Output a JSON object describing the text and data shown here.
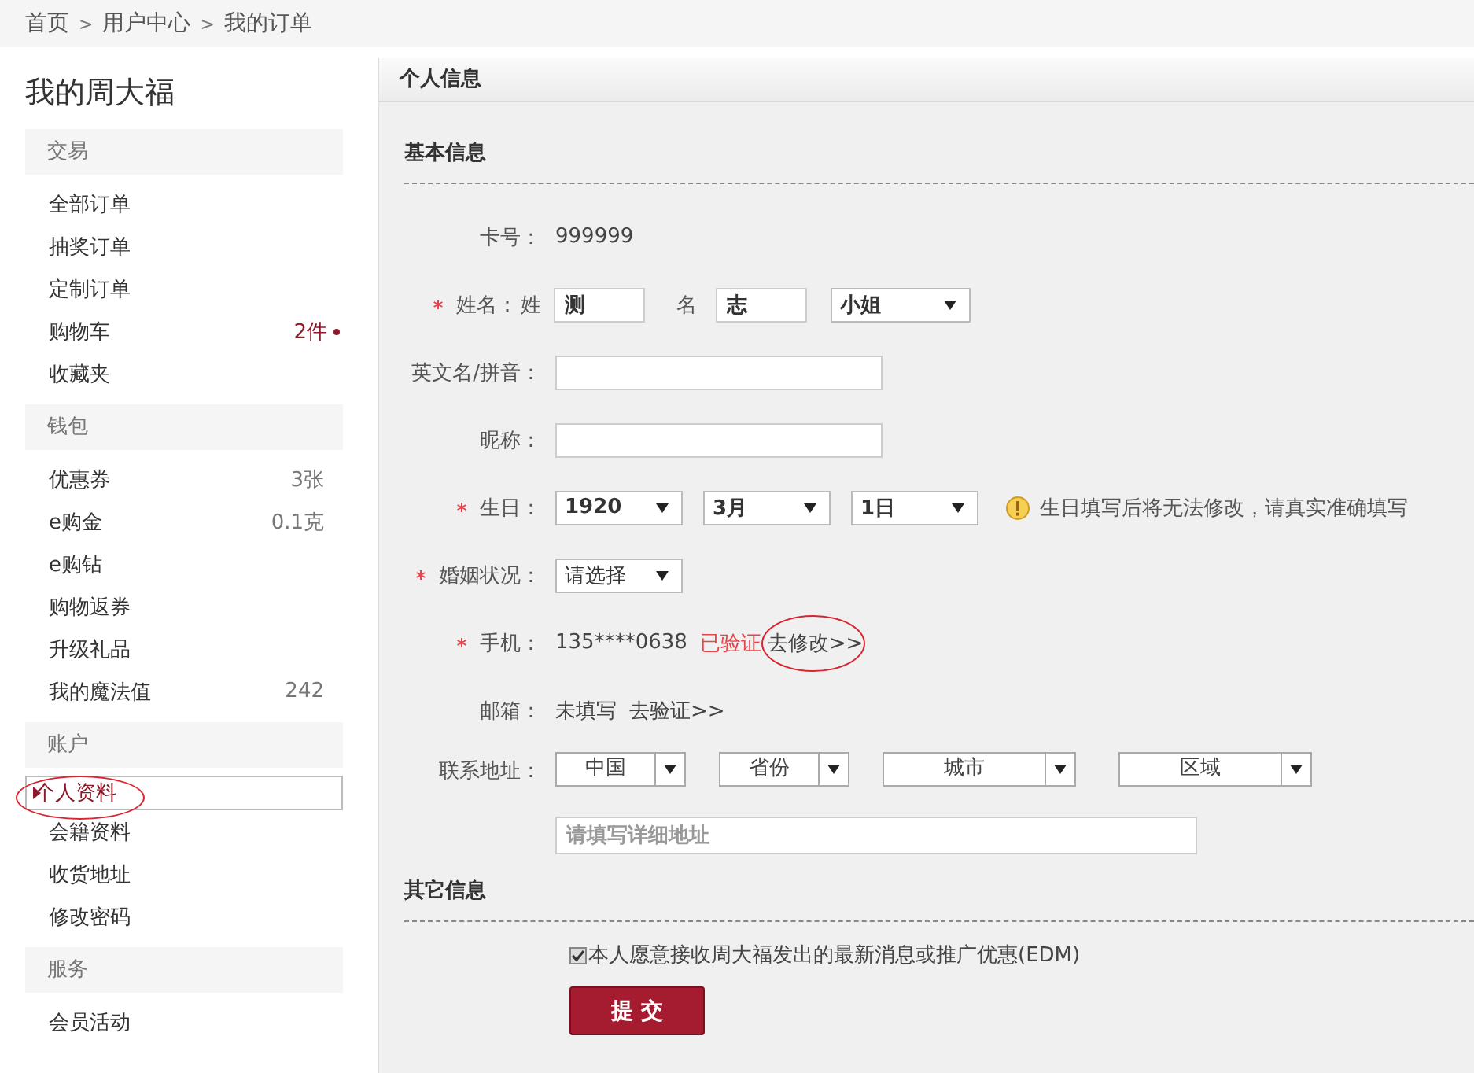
{
  "breadcrumb": [
    {
      "kind": "link",
      "text": "首页"
    },
    {
      "kind": "sep",
      "text": ">"
    },
    {
      "kind": "link",
      "text": "用户中心"
    },
    {
      "kind": "sep",
      "text": ">"
    },
    {
      "kind": "link",
      "text": "我的订单"
    }
  ],
  "sidebar": {
    "title": "我的周大福",
    "groups": [
      {
        "heading": "交易",
        "items": [
          {
            "label": "全部订单",
            "selected": false
          },
          {
            "label": "抽奖订单",
            "selected": false
          },
          {
            "label": "定制订单",
            "selected": false
          },
          {
            "label": "购物车",
            "selected": false,
            "count": "2件",
            "alert": true
          },
          {
            "label": "收藏夹",
            "selected": false
          }
        ]
      },
      {
        "heading": "钱包",
        "items": [
          {
            "label": "优惠券",
            "selected": false,
            "count": "3张",
            "alert": false
          },
          {
            "label": "e购金",
            "selected": false,
            "count": "0.1克",
            "alert": false
          },
          {
            "label": "e购钻",
            "selected": false
          },
          {
            "label": "购物返券",
            "selected": false
          },
          {
            "label": "升级礼品",
            "selected": false
          },
          {
            "label": "我的魔法值",
            "selected": false,
            "count": "242",
            "alert": false
          }
        ]
      },
      {
        "heading": "账户",
        "items": [
          {
            "label": "个人资料",
            "selected": true,
            "circled": true
          },
          {
            "label": "会籍资料",
            "selected": false
          },
          {
            "label": "收货地址",
            "selected": false
          },
          {
            "label": "修改密码",
            "selected": false
          }
        ]
      },
      {
        "heading": "服务",
        "items": [
          {
            "label": "会员活动",
            "selected": false
          }
        ]
      }
    ]
  },
  "main": {
    "title": "个人信息",
    "basic": {
      "heading": "基本信息",
      "rows": [
        {
          "kind": "text",
          "label": "卡号：",
          "required": false,
          "value": "999999"
        },
        {
          "kind": "name",
          "label": "姓名：",
          "required": true,
          "surname_label": "姓",
          "surname": "测",
          "given_label": "名",
          "given": "志",
          "salutation": "小姐"
        },
        {
          "kind": "input",
          "label": "英文名/拼音：",
          "required": false
        },
        {
          "kind": "input",
          "label": "昵称：",
          "required": false
        },
        {
          "kind": "birthday",
          "label": "生日：",
          "required": true,
          "selects": [
            "1920",
            "3月",
            "1日"
          ],
          "warning": "生日填写后将无法修改，请真实准确填写"
        },
        {
          "kind": "select",
          "label": "婚姻状况：",
          "required": true,
          "value": "请选择"
        },
        {
          "kind": "phone",
          "label": "手机：",
          "required": true,
          "value": "135****0638",
          "status": "已验证",
          "link": "去修改>>",
          "circled": true
        },
        {
          "kind": "email",
          "label": "邮箱：",
          "required": false,
          "value": "未填写",
          "link": "去验证>>"
        },
        {
          "kind": "address",
          "label": "联系地址：",
          "required": false,
          "selects": [
            "中国",
            "省份",
            "城市",
            "区域"
          ],
          "placeholder": "请填写详细地址"
        }
      ]
    },
    "other": {
      "heading": "其它信息",
      "consent": {
        "checked": true,
        "label": "本人愿意接收周大福发出的最新消息或推广优惠(EDM)"
      },
      "submit": "提 交"
    }
  }
}
